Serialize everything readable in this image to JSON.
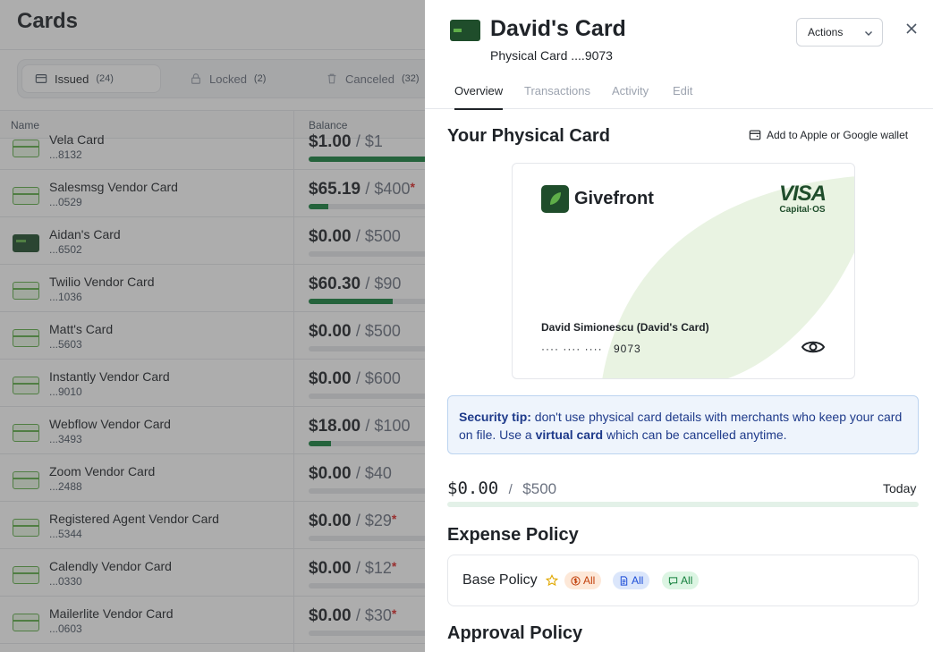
{
  "page": {
    "title": "Cards",
    "segments": [
      {
        "label": "Issued",
        "count": "(24)"
      },
      {
        "label": "Locked",
        "count": "(2)"
      },
      {
        "label": "Canceled",
        "count": "(32)"
      }
    ],
    "columns": {
      "name": "Name",
      "balance": "Balance"
    }
  },
  "rows": [
    {
      "name": "Vela Card",
      "num": "...8132",
      "spent": "$1.00",
      "limit": "/ $1",
      "starred": false,
      "dark": false,
      "progress": 1.0
    },
    {
      "name": "Salesmsg Vendor Card",
      "num": "...0529",
      "spent": "$65.19",
      "limit": "/ $400",
      "starred": true,
      "dark": false,
      "progress": 0.16
    },
    {
      "name": "Aidan's Card",
      "num": "...6502",
      "spent": "$0.00",
      "limit": "/ $500",
      "starred": false,
      "dark": true,
      "progress": 0
    },
    {
      "name": "Twilio Vendor Card",
      "num": "...1036",
      "spent": "$60.30",
      "limit": "/ $90",
      "starred": false,
      "dark": false,
      "progress": 0.67
    },
    {
      "name": "Matt's Card",
      "num": "...5603",
      "spent": "$0.00",
      "limit": "/ $500",
      "starred": false,
      "dark": false,
      "progress": 0
    },
    {
      "name": "Instantly Vendor Card",
      "num": "...9010",
      "spent": "$0.00",
      "limit": "/ $600",
      "starred": false,
      "dark": false,
      "progress": 0
    },
    {
      "name": "Webflow Vendor Card",
      "num": "...3493",
      "spent": "$18.00",
      "limit": "/ $100",
      "starred": false,
      "dark": false,
      "progress": 0.18
    },
    {
      "name": "Zoom Vendor Card",
      "num": "...2488",
      "spent": "$0.00",
      "limit": "/ $40",
      "starred": false,
      "dark": false,
      "progress": 0
    },
    {
      "name": "Registered Agent Vendor Card",
      "num": "...5344",
      "spent": "$0.00",
      "limit": "/ $29",
      "starred": true,
      "dark": false,
      "progress": 0
    },
    {
      "name": "Calendly Vendor Card",
      "num": "...0330",
      "spent": "$0.00",
      "limit": "/ $12",
      "starred": true,
      "dark": false,
      "progress": 0
    },
    {
      "name": "Mailerlite Vendor Card",
      "num": "...0603",
      "spent": "$0.00",
      "limit": "/ $30",
      "starred": true,
      "dark": false,
      "progress": 0
    }
  ],
  "drawer": {
    "title": "David's Card",
    "subtitle": "Physical Card ....9073",
    "actions_label": "Actions",
    "tabs": [
      "Overview",
      "Transactions",
      "Activity",
      "Edit"
    ],
    "section_card": "Your Physical Card",
    "wallet_label": "Add to Apple or Google wallet",
    "card": {
      "brand": "Givefront",
      "network": "VISA",
      "issuer": "Capital·OS",
      "holder": "David Simionescu (David's Card)",
      "masked": "···· ···· ····",
      "last4": "9073"
    },
    "tip": {
      "lead": "Security tip:",
      "text1": " don't use physical card details with merchants who keep your card on file. Use a ",
      "link": "virtual card",
      "text2": " which can be cancelled anytime."
    },
    "spend": {
      "spent": "$0.00",
      "sep": "/",
      "limit": "$500",
      "period": "Today",
      "progress": 0
    },
    "expense_policy_title": "Expense Policy",
    "policy": {
      "name": "Base Policy",
      "tags": [
        "All",
        "All",
        "All"
      ]
    },
    "approval_policy_title": "Approval Policy"
  }
}
